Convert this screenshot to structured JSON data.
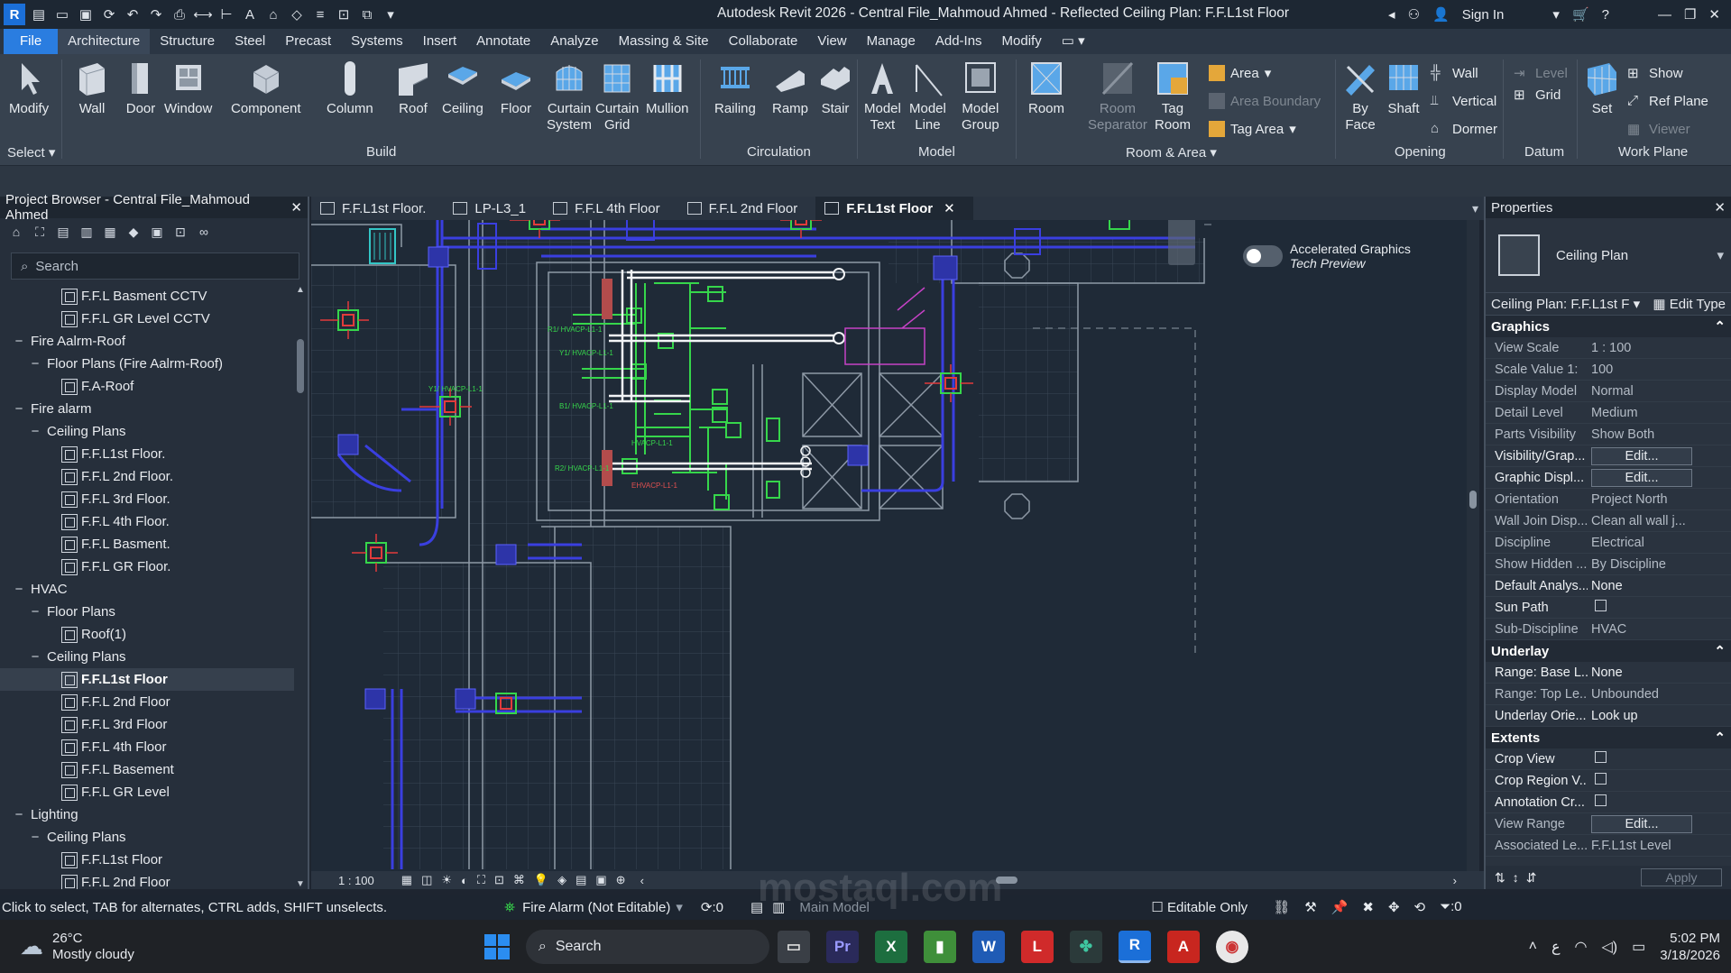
{
  "window": {
    "title": "Autodesk Revit 2026 - Central File_Mahmoud Ahmed - Reflected Ceiling Plan: F.F.L1st  Floor",
    "sign_in": "Sign In"
  },
  "menu": [
    "File",
    "Architecture",
    "Structure",
    "Steel",
    "Precast",
    "Systems",
    "Insert",
    "Annotate",
    "Analyze",
    "Massing & Site",
    "Collaborate",
    "View",
    "Manage",
    "Add-Ins",
    "Modify"
  ],
  "ribbon": {
    "modify": "Modify",
    "select_label": "Select",
    "build": [
      "Wall",
      "Door",
      "Window",
      "Component",
      "Column",
      "Roof",
      "Ceiling",
      "Floor"
    ],
    "curtain_system": [
      "Curtain",
      "System"
    ],
    "curtain_grid": [
      "Curtain",
      "Grid"
    ],
    "mullion": "Mullion",
    "build_label": "Build",
    "circulation": [
      "Railing",
      "Ramp",
      "Stair"
    ],
    "circulation_label": "Circulation",
    "model_text": [
      "Model",
      "Text"
    ],
    "model_line": [
      "Model",
      "Line"
    ],
    "model_group": [
      "Model",
      "Group"
    ],
    "model_label": "Model",
    "room": "Room",
    "room_separator": [
      "Room",
      "Separator"
    ],
    "tag_room": [
      "Tag",
      "Room"
    ],
    "area": "Area",
    "area_boundary": "Area  Boundary",
    "tag_area": "Tag  Area",
    "room_area_label": "Room & Area",
    "by_face": [
      "By",
      "Face"
    ],
    "shaft": "Shaft",
    "wall": "Wall",
    "vertical": "Vertical",
    "dormer": "Dormer",
    "opening_label": "Opening",
    "level": "Level",
    "grid": "Grid",
    "datum_label": "Datum",
    "set": "Set",
    "show": "Show",
    "ref_plane": "Ref  Plane",
    "viewer": "Viewer",
    "work_plane_label": "Work Plane"
  },
  "project_browser": {
    "title": "Project Browser - Central File_Mahmoud Ahmed",
    "search_placeholder": "Search",
    "items": [
      {
        "label": "F.F.L Basment CCTV",
        "indent": 3,
        "toggle": ""
      },
      {
        "label": "F.F.L GR Level CCTV",
        "indent": 3,
        "toggle": ""
      },
      {
        "label": "Fire Aalrm-Roof",
        "indent": 1,
        "toggle": "−"
      },
      {
        "label": "Floor Plans (Fire Aalrm-Roof)",
        "indent": 2,
        "toggle": "−"
      },
      {
        "label": "F.A-Roof",
        "indent": 3,
        "toggle": ""
      },
      {
        "label": "Fire alarm",
        "indent": 1,
        "toggle": "−"
      },
      {
        "label": "Ceiling Plans",
        "indent": 2,
        "toggle": "−"
      },
      {
        "label": "F.F.L1st Floor.",
        "indent": 3,
        "toggle": ""
      },
      {
        "label": "F.F.L 2nd Floor.",
        "indent": 3,
        "toggle": ""
      },
      {
        "label": "F.F.L 3rd Floor.",
        "indent": 3,
        "toggle": ""
      },
      {
        "label": "F.F.L 4th Floor.",
        "indent": 3,
        "toggle": ""
      },
      {
        "label": "F.F.L Basment.",
        "indent": 3,
        "toggle": ""
      },
      {
        "label": "F.F.L GR Floor.",
        "indent": 3,
        "toggle": ""
      },
      {
        "label": "HVAC",
        "indent": 1,
        "toggle": "−"
      },
      {
        "label": "Floor Plans",
        "indent": 2,
        "toggle": "−"
      },
      {
        "label": "Roof(1)",
        "indent": 3,
        "toggle": ""
      },
      {
        "label": "Ceiling Plans",
        "indent": 2,
        "toggle": "−"
      },
      {
        "label": "F.F.L1st Floor",
        "indent": 3,
        "toggle": "",
        "selected": true
      },
      {
        "label": "F.F.L 2nd Floor",
        "indent": 3,
        "toggle": ""
      },
      {
        "label": "F.F.L 3rd Floor",
        "indent": 3,
        "toggle": ""
      },
      {
        "label": "F.F.L 4th Floor",
        "indent": 3,
        "toggle": ""
      },
      {
        "label": "F.F.L Basement",
        "indent": 3,
        "toggle": ""
      },
      {
        "label": "F.F.L GR Level",
        "indent": 3,
        "toggle": ""
      },
      {
        "label": "Lighting",
        "indent": 1,
        "toggle": "−"
      },
      {
        "label": "Ceiling Plans",
        "indent": 2,
        "toggle": "−"
      },
      {
        "label": "F.F.L1st Floor",
        "indent": 3,
        "toggle": ""
      },
      {
        "label": "F.F.L 2nd Floor",
        "indent": 3,
        "toggle": ""
      }
    ]
  },
  "tabs": [
    {
      "label": "F.F.L1st Floor.",
      "active": false
    },
    {
      "label": "LP-L3_1",
      "active": false
    },
    {
      "label": "F.F.L 4th  Floor",
      "active": false
    },
    {
      "label": "F.F.L 2nd  Floor",
      "active": false
    },
    {
      "label": "F.F.L1st  Floor",
      "active": true
    }
  ],
  "canvas": {
    "accelerated_graphics": "Accelerated Graphics",
    "tech_preview": "Tech Preview",
    "tags": [
      "R1/ HVACP-L1-1",
      "Y1/ HVACP-L1-1",
      "Y1/ HVACP-L1-1",
      "B1/ HVACP-L1-1",
      "HVACP-L1-1",
      "R2/ HVACP-L1-1",
      "EHVACP-L1-1"
    ]
  },
  "view_bar": {
    "scale": "1 : 100"
  },
  "properties": {
    "title": "Properties",
    "type_name": "Ceiling Plan",
    "selector": "Ceiling Plan: F.F.L1st  F",
    "edit_type": "Edit Type",
    "apply": "Apply",
    "groups": [
      {
        "name": "Graphics",
        "rows": [
          {
            "name": "View Scale",
            "value": "1 : 100",
            "kind": "text",
            "bright": false
          },
          {
            "name": "Scale Value    1:",
            "value": "100",
            "kind": "text",
            "bright": false
          },
          {
            "name": "Display Model",
            "value": "Normal",
            "kind": "text",
            "bright": false
          },
          {
            "name": "Detail Level",
            "value": "Medium",
            "kind": "text",
            "bright": false
          },
          {
            "name": "Parts Visibility",
            "value": "Show Both",
            "kind": "text",
            "bright": false
          },
          {
            "name": "Visibility/Grap...",
            "value": "Edit...",
            "kind": "button",
            "bright": true
          },
          {
            "name": "Graphic Displ...",
            "value": "Edit...",
            "kind": "button",
            "bright": true
          },
          {
            "name": "Orientation",
            "value": "Project North",
            "kind": "text",
            "bright": false
          },
          {
            "name": "Wall Join Disp...",
            "value": "Clean all wall j...",
            "kind": "text",
            "bright": false
          },
          {
            "name": "Discipline",
            "value": "Electrical",
            "kind": "text",
            "bright": false
          },
          {
            "name": "Show Hidden ...",
            "value": "By Discipline",
            "kind": "text",
            "bright": false
          },
          {
            "name": "Default Analys...",
            "value": "None",
            "kind": "text",
            "bright": true
          },
          {
            "name": "Sun Path",
            "value": "",
            "kind": "check",
            "bright": true
          },
          {
            "name": "Sub-Discipline",
            "value": "HVAC",
            "kind": "text",
            "bright": false
          }
        ]
      },
      {
        "name": "Underlay",
        "rows": [
          {
            "name": "Range: Base L...",
            "value": "None",
            "kind": "text",
            "bright": true
          },
          {
            "name": "Range: Top Le...",
            "value": "Unbounded",
            "kind": "text",
            "bright": false
          },
          {
            "name": "Underlay Orie...",
            "value": "Look up",
            "kind": "text",
            "bright": true
          }
        ]
      },
      {
        "name": "Extents",
        "rows": [
          {
            "name": "Crop View",
            "value": "",
            "kind": "check",
            "bright": true
          },
          {
            "name": "Crop Region V...",
            "value": "",
            "kind": "check",
            "bright": true
          },
          {
            "name": "Annotation Cr...",
            "value": "",
            "kind": "check",
            "bright": true
          },
          {
            "name": "View Range",
            "value": "Edit...",
            "kind": "button",
            "bright": false
          },
          {
            "name": "Associated Le...",
            "value": "F.F.L1st Level",
            "kind": "text",
            "bright": false
          }
        ]
      }
    ]
  },
  "status": {
    "hint": "Click to select, TAB for alternates, CTRL adds, SHIFT unselects.",
    "workset": "Fire Alarm (Not Editable)",
    "count": ":0",
    "model": "Main Model",
    "editable_only": "Editable Only",
    "filter_count": ":0"
  },
  "taskbar": {
    "temperature": "26°C",
    "weather": "Mostly cloudy",
    "search": "Search",
    "time": "5:02 PM",
    "date": "3/18/2026"
  },
  "watermark": "mostaql.com"
}
